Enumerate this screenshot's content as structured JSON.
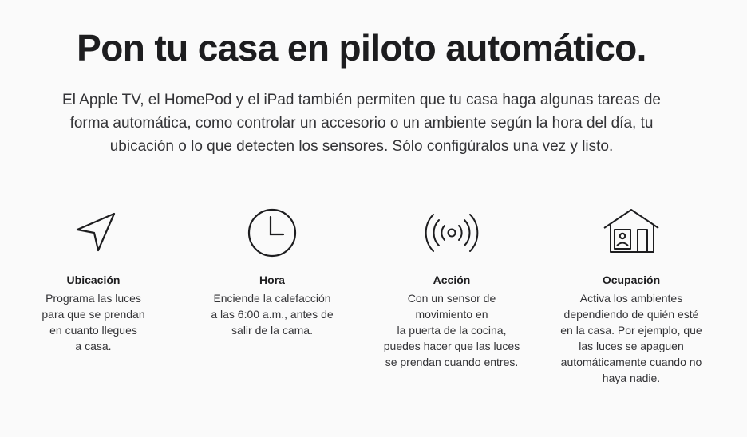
{
  "headline": "Pon tu casa en piloto automático.",
  "intro": {
    "lines": [
      "El Apple TV, el HomePod y el iPad también permiten que tu casa haga algunas tareas de",
      "forma automática, como controlar un accesorio o un ambiente según la hora del día, tu",
      "ubicación o lo que detecten los sensores. Sólo configúralos una vez y listo."
    ]
  },
  "features": [
    {
      "icon": "location-arrow-icon",
      "title": "Ubicación",
      "lines": [
        "Programa las luces",
        "para que se prendan",
        "en cuanto llegues",
        "a casa."
      ]
    },
    {
      "icon": "clock-icon",
      "title": "Hora",
      "lines": [
        "Enciende la calefacción",
        "a las 6:00 a.m., antes de",
        "salir de la cama."
      ]
    },
    {
      "icon": "motion-sensor-icon",
      "title": "Acción",
      "lines": [
        "Con un sensor de",
        "movimiento en",
        "la puerta de la cocina,",
        "puedes hacer que las luces",
        "se prendan cuando entres."
      ]
    },
    {
      "icon": "home-occupancy-icon",
      "title": "Ocupación",
      "lines": [
        "Activa los ambientes",
        "dependiendo de quién esté",
        "en la casa. Por ejemplo, que",
        "las luces se apaguen",
        "automáticamente cuando no",
        "haya nadie."
      ]
    }
  ]
}
